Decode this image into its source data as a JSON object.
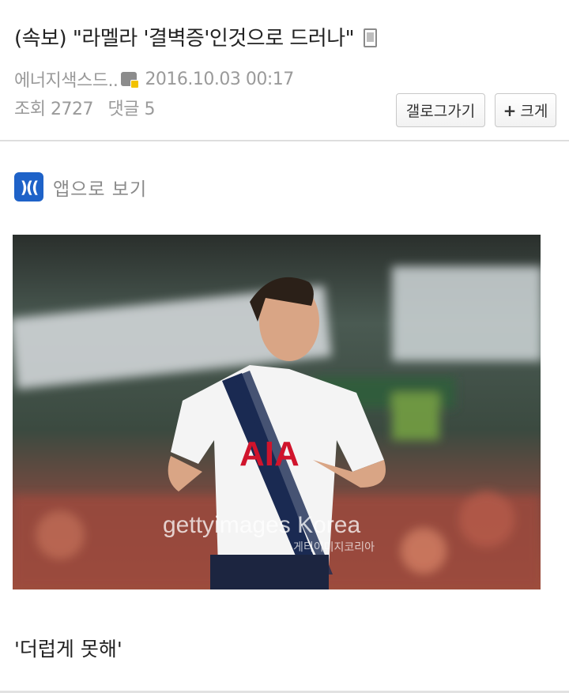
{
  "post": {
    "title": "(속보) \"라멜라 '결벽증'인것으로 드러나\"",
    "author": "에너지색스드..",
    "datetime": "2016.10.03 00:17",
    "views_label": "조회",
    "views": "2727",
    "comments_label": "댓글",
    "comments": "5",
    "body": "'더럽게 못해'"
  },
  "buttons": {
    "gallery": "갤로그가기",
    "enlarge_icon": "+",
    "enlarge": "크게"
  },
  "app_link": {
    "icon_text": ")((",
    "label": "앱으로 보기"
  },
  "image": {
    "shirt_text": "AIA",
    "watermark": "gettyimages Korea",
    "watermark_sub": "게티이미지코리아"
  },
  "colors": {
    "app_icon": "#1e62c8",
    "divider": "#dedede"
  }
}
